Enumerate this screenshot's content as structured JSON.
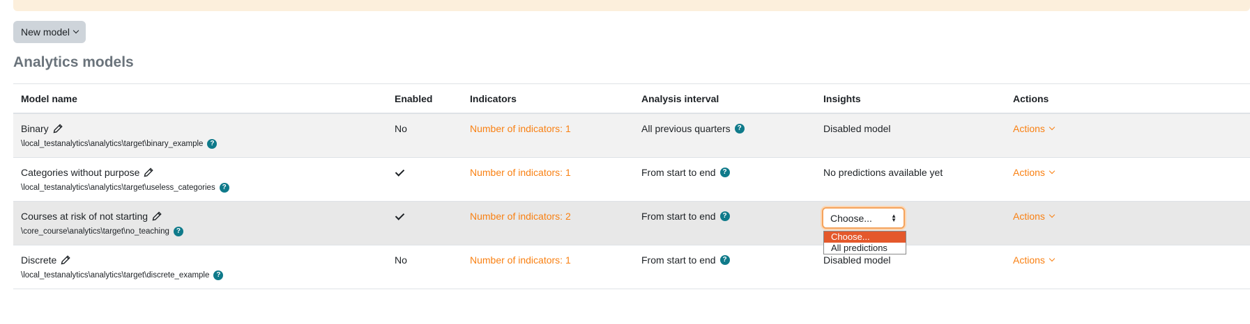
{
  "header": {
    "new_model_label": "New model",
    "page_title": "Analytics models"
  },
  "table": {
    "headers": {
      "name": "Model name",
      "enabled": "Enabled",
      "indicators": "Indicators",
      "interval": "Analysis interval",
      "insights": "Insights",
      "actions": "Actions"
    },
    "rows": [
      {
        "name": "Binary",
        "target": "\\local_testanalytics\\analytics\\target\\binary_example",
        "enabled": "No",
        "indicators": "Number of indicators: 1",
        "interval": "All previous quarters",
        "insights": "Disabled model",
        "actions": "Actions"
      },
      {
        "name": "Categories without purpose",
        "target": "\\local_testanalytics\\analytics\\target\\useless_categories",
        "enabled": "",
        "indicators": "Number of indicators: 1",
        "interval": "From start to end",
        "insights": "No predictions available yet",
        "actions": "Actions"
      },
      {
        "name": "Courses at risk of not starting",
        "target": "\\core_course\\analytics\\target\\no_teaching",
        "enabled": "",
        "indicators": "Number of indicators: 2",
        "interval": "From start to end",
        "insights_select": "Choose...",
        "actions": "Actions"
      },
      {
        "name": "Discrete",
        "target": "\\local_testanalytics\\analytics\\target\\discrete_example",
        "enabled": "No",
        "indicators": "Number of indicators: 1",
        "interval": "From start to end",
        "insights": "Disabled model",
        "actions": "Actions"
      }
    ]
  },
  "insights_dropdown": {
    "options": [
      "Choose...",
      "All predictions"
    ],
    "selected": "Choose..."
  },
  "colors": {
    "link": "#f98012",
    "help_icon": "#0f7a8a",
    "selected_option": "#e4582b"
  }
}
